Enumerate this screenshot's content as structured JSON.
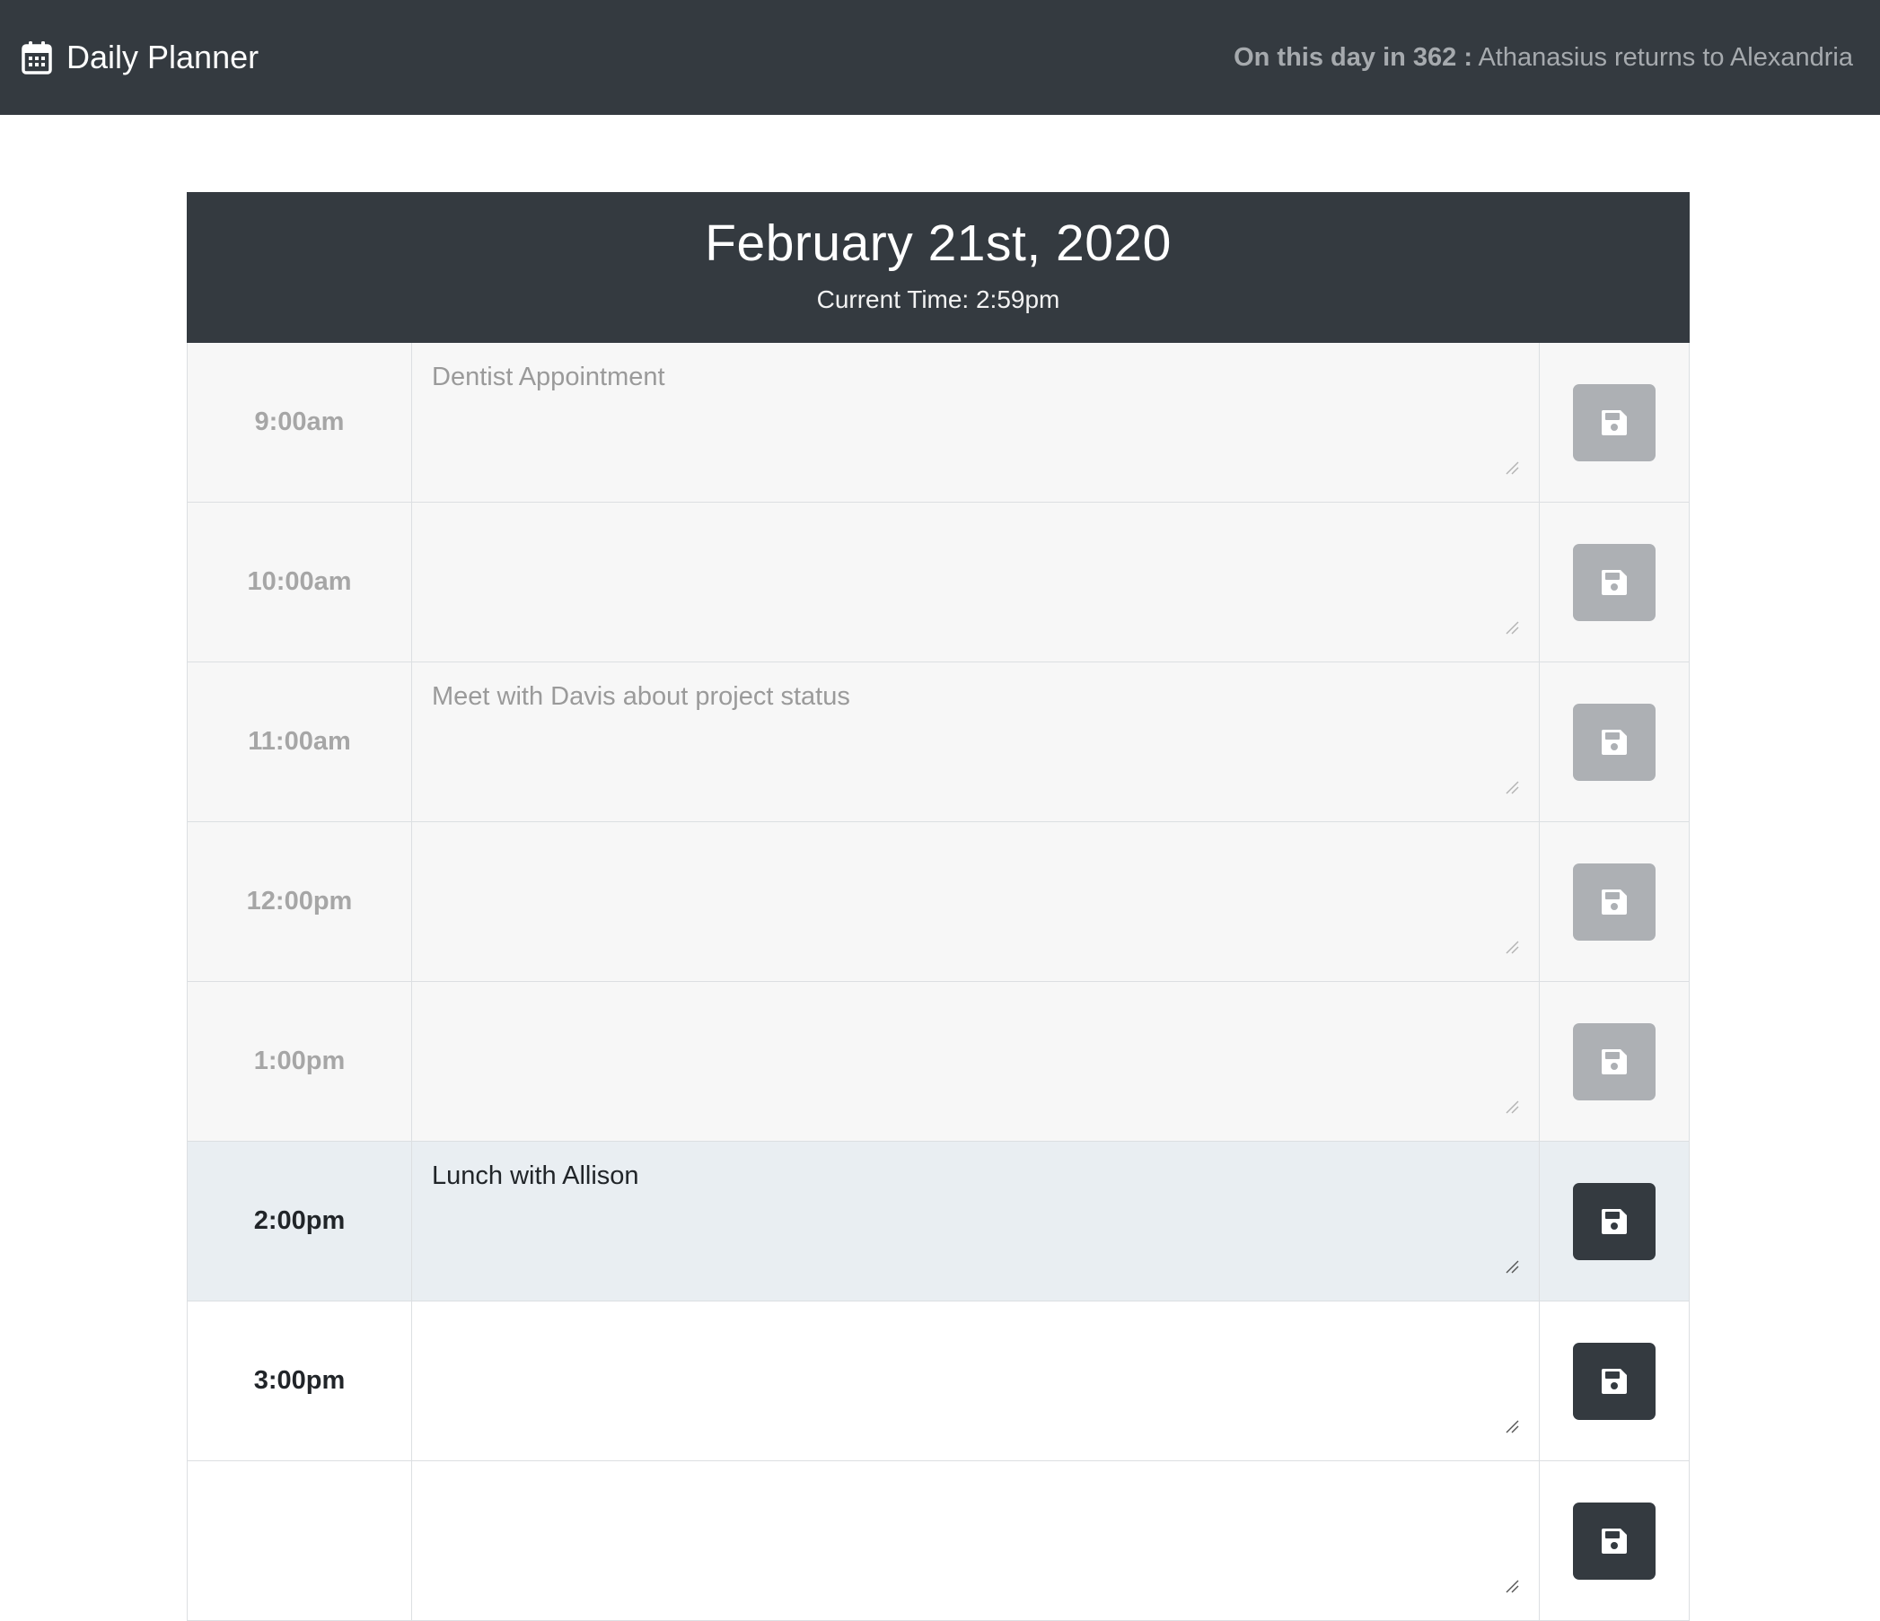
{
  "navbar": {
    "brand_icon": "calendar-icon",
    "brand_title": "Daily Planner",
    "history_label": "On this day in 362 :",
    "history_text": "Athanasius returns to Alexandria"
  },
  "header": {
    "date": "February 21st, 2020",
    "current_time": "Current Time: 2:59pm"
  },
  "colors": {
    "navbar_bg": "#343a40",
    "past_row_bg": "#f7f7f7",
    "present_row_bg": "#e9eef2",
    "future_row_bg": "#ffffff",
    "past_button": "#adb0b4",
    "active_button": "#343a40"
  },
  "save_icon": "floppy-disk-icon",
  "rows": [
    {
      "time": "9:00am",
      "description": "Dentist Appointment",
      "state": "past"
    },
    {
      "time": "10:00am",
      "description": "",
      "state": "past"
    },
    {
      "time": "11:00am",
      "description": "Meet with Davis about project status",
      "state": "past"
    },
    {
      "time": "12:00pm",
      "description": "",
      "state": "past"
    },
    {
      "time": "1:00pm",
      "description": "",
      "state": "past"
    },
    {
      "time": "2:00pm",
      "description": "Lunch with Allison",
      "state": "present"
    },
    {
      "time": "3:00pm",
      "description": "",
      "state": "future"
    },
    {
      "time": "",
      "description": "",
      "state": "future"
    }
  ]
}
